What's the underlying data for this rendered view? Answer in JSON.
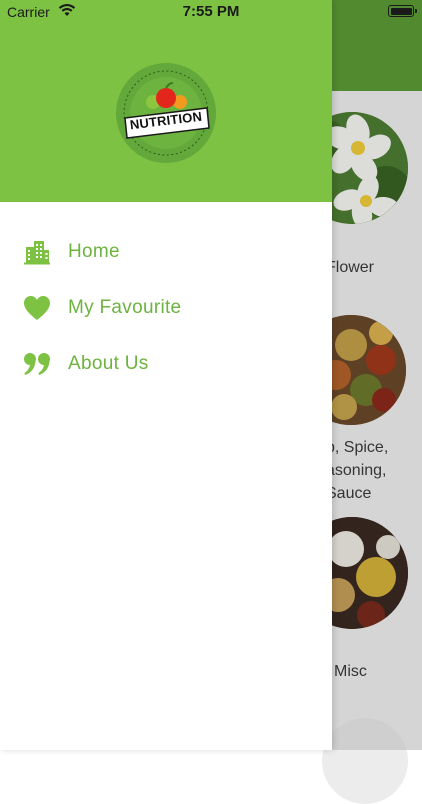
{
  "status_bar": {
    "carrier": "Carrier",
    "time": "7:55 PM"
  },
  "colors": {
    "brand_green": "#7dc243",
    "dark_green": "#5e9e36",
    "menu_text": "#6cb33f"
  },
  "drawer": {
    "logo_text": "NUTRITION",
    "menu": [
      {
        "label": "Home",
        "icon": "building-icon"
      },
      {
        "label": "My Favourite",
        "icon": "heart-icon"
      },
      {
        "label": "About Us",
        "icon": "quote-icon"
      }
    ]
  },
  "background_list": {
    "items": [
      {
        "label": "Flower",
        "image": "plumeria-flowers"
      },
      {
        "label": "b, Spice,\nasoning,\nSauce",
        "image": "spice-bowls"
      },
      {
        "label": "Misc",
        "image": "misc-bowls"
      }
    ]
  }
}
